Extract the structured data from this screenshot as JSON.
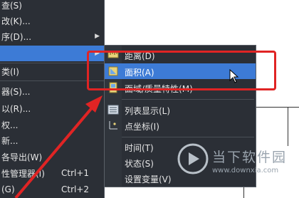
{
  "main_menu": {
    "items": [
      {
        "label": "查(S)",
        "underline_hint": "S"
      },
      {
        "label": "改(K)..."
      },
      {
        "label": "序(D)...",
        "has_submenu": true
      },
      {
        "label": "",
        "has_submenu": true,
        "highlighted": true
      },
      {
        "label": "类(I)"
      },
      {
        "label": "器(S)..."
      },
      {
        "label": "以(R)..."
      },
      {
        "label": "权..."
      },
      {
        "label": "新..."
      },
      {
        "label": "各导出(W)"
      },
      {
        "label": "性管理器(I)",
        "shortcut": "Ctrl+1"
      },
      {
        "label": "(G)",
        "shortcut": "Ctrl+2"
      }
    ]
  },
  "submenu": {
    "items": [
      {
        "label": "距离(D)",
        "icon": "ruler-icon"
      },
      {
        "label": "面积(A)",
        "icon": "area-icon",
        "highlighted": true
      },
      {
        "label": "面域/质量特性(M)",
        "icon": "mass-properties-icon"
      },
      {
        "label": "列表显示(L)",
        "icon": "list-icon"
      },
      {
        "label": "点坐标(I)",
        "icon": "point-coordinate-icon"
      },
      {
        "label": "时间(T)",
        "icon": ""
      },
      {
        "label": "状态(S)",
        "icon": ""
      },
      {
        "label": "设置变量(V)",
        "icon": ""
      }
    ]
  },
  "watermark": {
    "title": "当下软件园",
    "url": "www.downxia.com"
  },
  "colors": {
    "menu_bg": "#2b2f36",
    "highlight": "#3d7bd6",
    "annotation": "#e02424"
  }
}
